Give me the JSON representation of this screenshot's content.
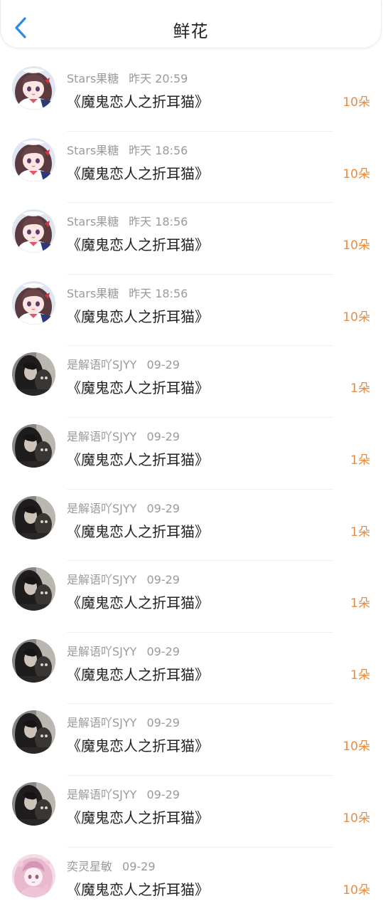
{
  "header": {
    "title": "鲜花",
    "back_icon": "chevron-left-icon",
    "accent_color": "#2a8be0"
  },
  "colors": {
    "count": "#ec8a3d",
    "meta": "#9a9a9a",
    "text": "#222222"
  },
  "gifts": [
    {
      "user": "Stars果糖",
      "time": "昨天 20:59",
      "work": "《魔鬼恋人之折耳猫》",
      "count": "10朵",
      "avatar": "anime-girl-avatar"
    },
    {
      "user": "Stars果糖",
      "time": "昨天 18:56",
      "work": "《魔鬼恋人之折耳猫》",
      "count": "10朵",
      "avatar": "anime-girl-avatar"
    },
    {
      "user": "Stars果糖",
      "time": "昨天 18:56",
      "work": "《魔鬼恋人之折耳猫》",
      "count": "10朵",
      "avatar": "anime-girl-avatar"
    },
    {
      "user": "Stars果糖",
      "time": "昨天 18:56",
      "work": "《魔鬼恋人之折耳猫》",
      "count": "10朵",
      "avatar": "anime-girl-avatar"
    },
    {
      "user": "是解语吖SJYY",
      "time": "09-29",
      "work": "《魔鬼恋人之折耳猫》",
      "count": "1朵",
      "avatar": "dark-photo-avatar"
    },
    {
      "user": "是解语吖SJYY",
      "time": "09-29",
      "work": "《魔鬼恋人之折耳猫》",
      "count": "1朵",
      "avatar": "dark-photo-avatar"
    },
    {
      "user": "是解语吖SJYY",
      "time": "09-29",
      "work": "《魔鬼恋人之折耳猫》",
      "count": "1朵",
      "avatar": "dark-photo-avatar"
    },
    {
      "user": "是解语吖SJYY",
      "time": "09-29",
      "work": "《魔鬼恋人之折耳猫》",
      "count": "1朵",
      "avatar": "dark-photo-avatar"
    },
    {
      "user": "是解语吖SJYY",
      "time": "09-29",
      "work": "《魔鬼恋人之折耳猫》",
      "count": "1朵",
      "avatar": "dark-photo-avatar"
    },
    {
      "user": "是解语吖SJYY",
      "time": "09-29",
      "work": "《魔鬼恋人之折耳猫》",
      "count": "10朵",
      "avatar": "dark-photo-avatar"
    },
    {
      "user": "是解语吖SJYY",
      "time": "09-29",
      "work": "《魔鬼恋人之折耳猫》",
      "count": "10朵",
      "avatar": "dark-photo-avatar"
    },
    {
      "user": "奕灵星敏",
      "time": "09-29",
      "work": "《魔鬼恋人之折耳猫》",
      "count": "10朵",
      "avatar": "pink-anime-avatar"
    }
  ]
}
